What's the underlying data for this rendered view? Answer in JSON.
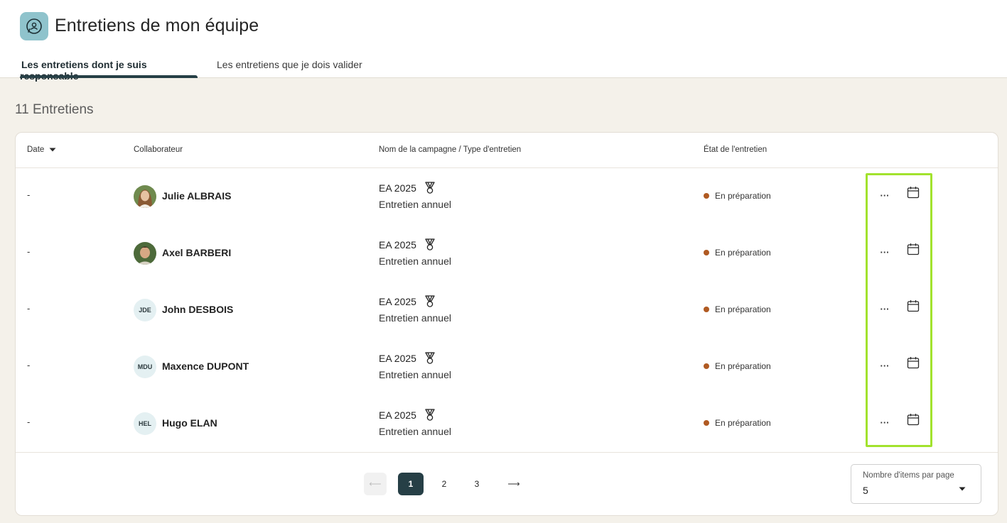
{
  "page": {
    "title": "Entretiens de mon équipe",
    "app_icon": "interview-bubble-icon",
    "accent_color": "#263f46",
    "highlight_color": "#a2e22d"
  },
  "tabs": [
    {
      "label": "Les entretiens dont je suis responsable",
      "active": true
    },
    {
      "label": "Les entretiens que je dois valider",
      "active": false
    }
  ],
  "summary": {
    "count_title": "11 Entretiens"
  },
  "table": {
    "headers": {
      "date": "Date",
      "collaborator": "Collaborateur",
      "campaign": "Nom de la campagne / Type d'entretien",
      "state": "État de l'entretien"
    },
    "sort": {
      "column": "date",
      "direction": "desc"
    },
    "rows": [
      {
        "date": "-",
        "initials": "",
        "avatar": "photo-woman",
        "name": "Julie ALBRAIS",
        "campaign": "EA 2025",
        "type": "Entretien annuel",
        "state": "En préparation",
        "state_color": "#b05a22",
        "more": "···"
      },
      {
        "date": "-",
        "initials": "",
        "avatar": "photo-man",
        "name": "Axel BARBERI",
        "campaign": "EA 2025",
        "type": "Entretien annuel",
        "state": "En préparation",
        "state_color": "#b05a22",
        "more": "···"
      },
      {
        "date": "-",
        "initials": "JDE",
        "avatar": "initials",
        "name": "John DESBOIS",
        "campaign": "EA 2025",
        "type": "Entretien annuel",
        "state": "En préparation",
        "state_color": "#b05a22",
        "more": "···"
      },
      {
        "date": "-",
        "initials": "MDU",
        "avatar": "initials",
        "name": "Maxence DUPONT",
        "campaign": "EA 2025",
        "type": "Entretien annuel",
        "state": "En préparation",
        "state_color": "#b05a22",
        "more": "···"
      },
      {
        "date": "-",
        "initials": "HEL",
        "avatar": "initials",
        "name": "Hugo ELAN",
        "campaign": "EA 2025",
        "type": "Entretien annuel",
        "state": "En préparation",
        "state_color": "#b05a22",
        "more": "···"
      }
    ]
  },
  "pagination": {
    "prev": "⟵",
    "pages": [
      "1",
      "2",
      "3"
    ],
    "current": "1",
    "next": "⟶",
    "per_page_label": "Nombre d'items par page",
    "per_page_value": "5"
  }
}
